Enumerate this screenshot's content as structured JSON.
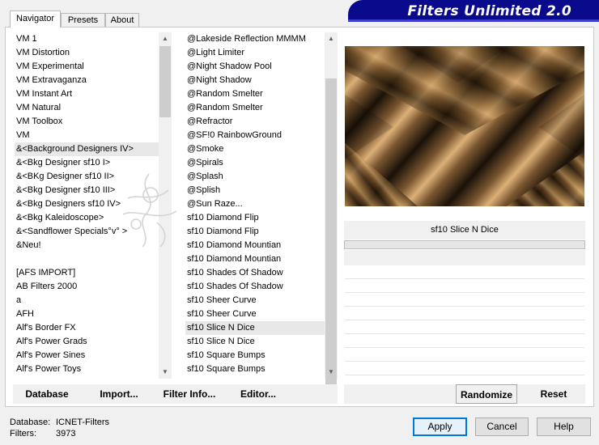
{
  "tabs": [
    "Navigator",
    "Presets",
    "About"
  ],
  "banner_title": "Filters Unlimited 2.0",
  "categories": [
    "VM 1",
    "VM Distortion",
    "VM Experimental",
    "VM Extravaganza",
    "VM Instant Art",
    "VM Natural",
    "VM Toolbox",
    "VM",
    "&<Background Designers IV>",
    "&<Bkg Designer sf10 I>",
    "&<BKg Designer sf10 II>",
    "&<Bkg Designer sf10 III>",
    "&<Bkg Designers sf10 IV>",
    "&<Bkg Kaleidoscope>",
    "&<Sandflower Specials°v° >",
    "&Neu!",
    "",
    "[AFS IMPORT]",
    "AB Filters 2000",
    "a",
    "AFH",
    "Alf's Border FX",
    "Alf's Power Grads",
    "Alf's Power Sines",
    "Alf's Power Toys"
  ],
  "categories_selected": 8,
  "filters": [
    "@Lakeside Reflection MMMM",
    "@Light Limiter",
    "@Night Shadow Pool",
    "@Night Shadow",
    "@Random Smelter",
    "@Random Smelter",
    "@Refractor",
    "@SF!0 RainbowGround",
    "@Smoke",
    "@Spirals",
    "@Splash",
    "@Splish",
    "@Sun Raze...",
    "sf10 Diamond Flip",
    "sf10 Diamond Flip",
    "sf10 Diamond Mountian",
    "sf10 Diamond Mountian",
    "sf10 Shades Of Shadow",
    "sf10 Shades Of Shadow",
    "sf10 Sheer Curve",
    "sf10 Sheer Curve",
    "sf10 Slice N Dice",
    "sf10 Slice N Dice",
    "sf10 Square Bumps",
    "sf10 Square Bumps"
  ],
  "filters_selected": 21,
  "current_filter": "sf10 Slice N Dice",
  "strip_buttons": [
    "Database",
    "Import...",
    "Filter Info...",
    "Editor..."
  ],
  "randomize_label": "Randomize",
  "reset_label": "Reset",
  "footer": {
    "database_label": "Database:",
    "database_value": "ICNET-Filters",
    "filters_label": "Filters:",
    "filters_value": "3973"
  },
  "buttons": {
    "apply": "Apply",
    "cancel": "Cancel",
    "help": "Help"
  },
  "colors": {
    "banner": "#0a0a8c",
    "banner_stripe": "#3b3bd0",
    "preview_light": "#d6aa70",
    "preview_dark": "#1e140a"
  }
}
